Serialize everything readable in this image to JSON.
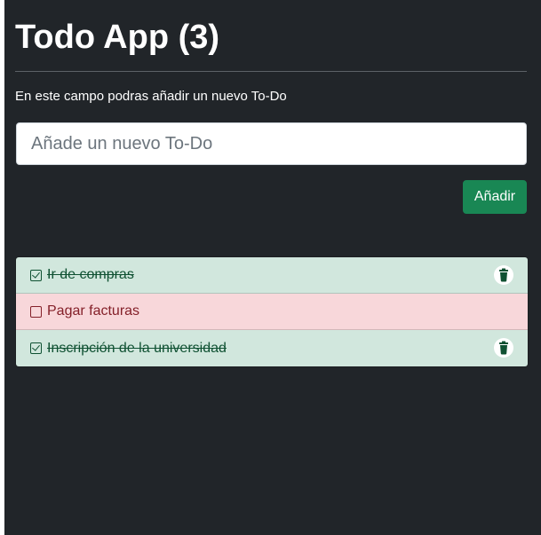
{
  "app": {
    "title": "Todo App (3)",
    "instructions": "En este campo podras añadir un nuevo To-Do"
  },
  "form": {
    "placeholder": "Añade un nuevo To-Do",
    "value": "",
    "add_label": "Añadir"
  },
  "todos": [
    {
      "label": "Ir de compras",
      "done": true,
      "checkbox_icon": "checked-square-icon",
      "delete_icon": "trash-icon"
    },
    {
      "label": "Pagar facturas",
      "done": false,
      "checkbox_icon": "empty-square-icon"
    },
    {
      "label": "Inscripción de la universidad",
      "done": true,
      "checkbox_icon": "checked-square-icon",
      "delete_icon": "trash-icon"
    }
  ],
  "colors": {
    "background": "#212529",
    "add_button": "#198754",
    "done_row": "#d1e7dd",
    "done_text": "#0f5132",
    "pending_row": "#f8d7da",
    "pending_text": "#842029"
  }
}
